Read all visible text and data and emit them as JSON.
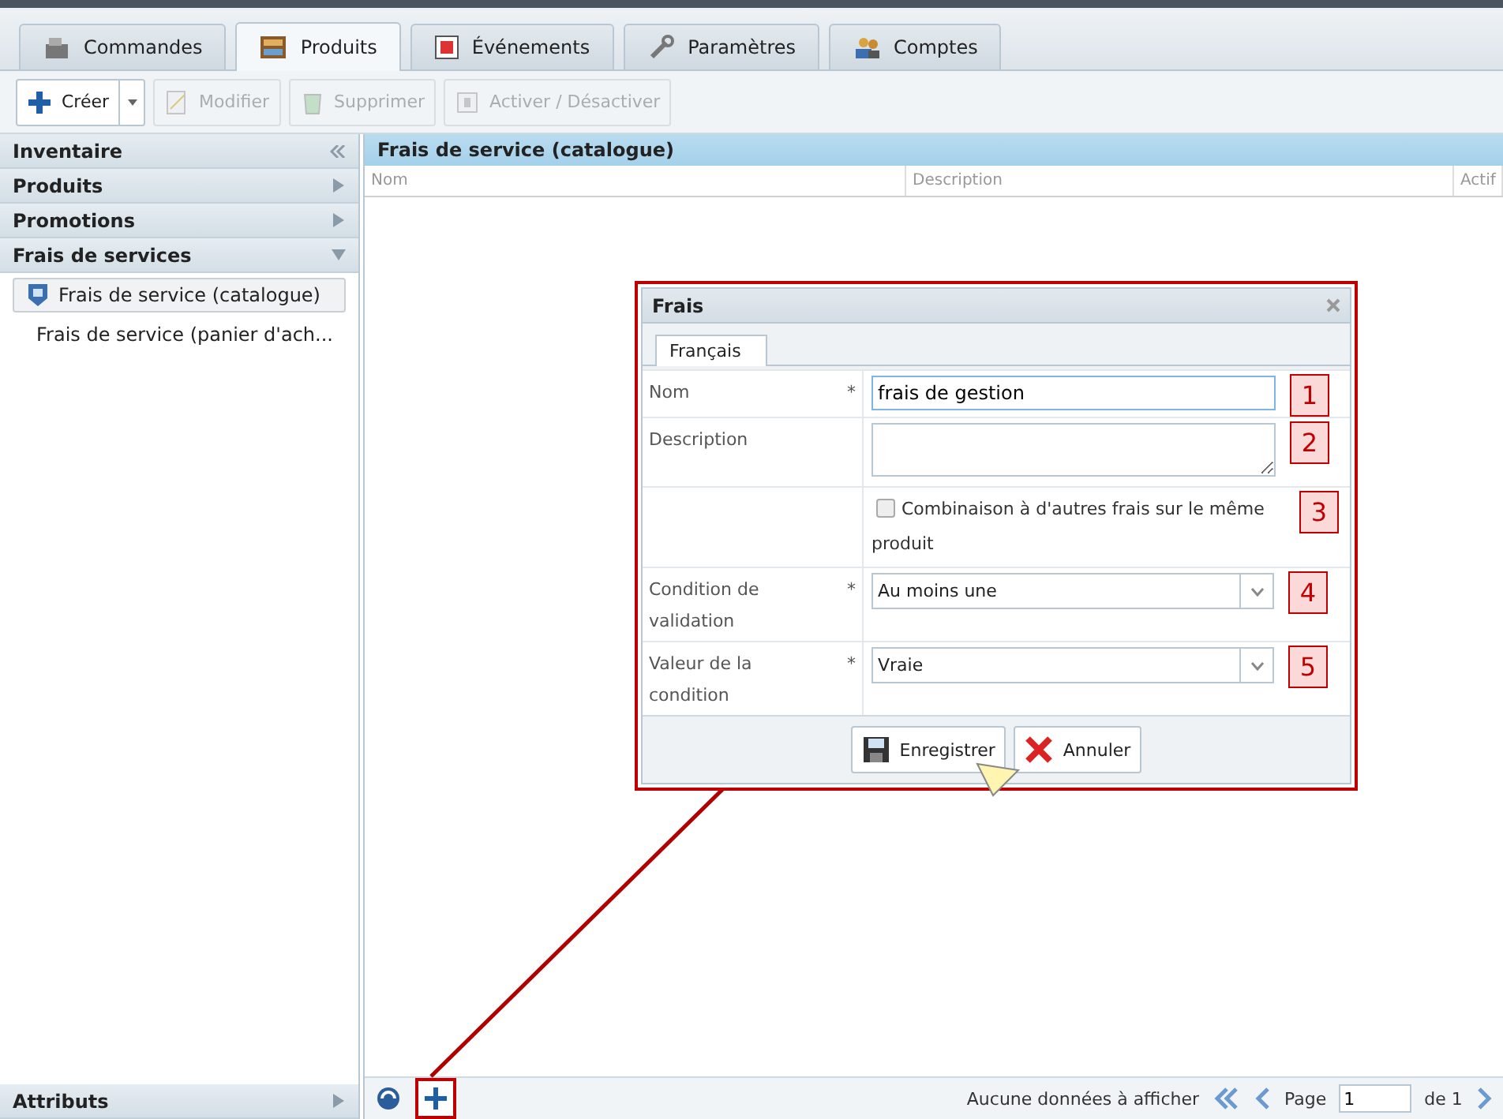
{
  "tabs": [
    {
      "label": "Commandes",
      "selected": false
    },
    {
      "label": "Produits",
      "selected": true
    },
    {
      "label": "Événements",
      "selected": false
    },
    {
      "label": "Paramètres",
      "selected": false
    },
    {
      "label": "Comptes",
      "selected": false
    }
  ],
  "toolbar": [
    {
      "label": "Créer",
      "disabled": false,
      "kind": "split"
    },
    {
      "label": "Modifier",
      "disabled": true,
      "kind": "plain"
    },
    {
      "label": "Supprimer",
      "disabled": true,
      "kind": "plain"
    },
    {
      "label": "Activer / Désactiver",
      "disabled": true,
      "kind": "plain"
    }
  ],
  "sidebar": {
    "sections": [
      {
        "label": "Inventaire",
        "kind": "header"
      },
      {
        "label": "Produits",
        "expanded": false,
        "kind": "section"
      },
      {
        "label": "Promotions",
        "expanded": false,
        "kind": "section"
      },
      {
        "label": "Frais de services",
        "expanded": true,
        "kind": "section",
        "items": [
          {
            "label": "Frais de service (catalogue)",
            "selected": true
          },
          {
            "label": "Frais de service (panier d'ach...",
            "selected": false
          }
        ]
      }
    ],
    "footer": {
      "label": "Attributs",
      "expanded": false
    }
  },
  "grid": {
    "title": "Frais de service (catalogue)",
    "columns": [
      "Nom",
      "Description",
      "Actif"
    ]
  },
  "dialog": {
    "title": "Frais",
    "tab": "Français",
    "fields": [
      {
        "kind": "text",
        "label": "Nom",
        "marker": "*",
        "value": "frais de gestion",
        "badge": "1"
      },
      {
        "kind": "textarea",
        "label": "Description",
        "badge": "2"
      },
      {
        "kind": "checkbox",
        "option": "Combinaison à d'autres frais sur le même produit",
        "checked": false,
        "badge": "3"
      },
      {
        "kind": "select",
        "label": "Condition de validation",
        "marker": "*",
        "value": "Au moins une",
        "badge": "4"
      },
      {
        "kind": "select",
        "label": "Valeur de la condition",
        "marker": "*",
        "value": "Vraie",
        "badge": "5"
      }
    ],
    "buttons": [
      {
        "label": "Enregistrer",
        "kind": "save"
      },
      {
        "label": "Annuler",
        "kind": "cancel"
      }
    ]
  },
  "pager": {
    "status": "Aucune données à afficher",
    "page_label": "Page",
    "page": "1",
    "of": "de 1"
  }
}
